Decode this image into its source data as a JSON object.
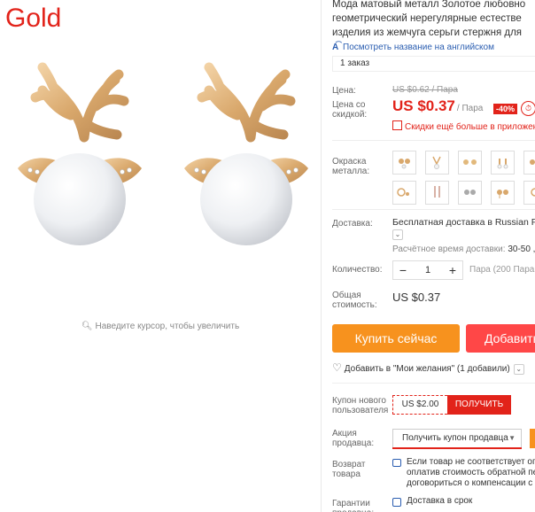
{
  "gallery": {
    "variant_label": "Gold",
    "zoom_hint": "Наведите курсор, чтобы увеличить"
  },
  "product": {
    "title_lines": [
      "Мода матовый металл Золотое любовно",
      "геометрический нерегулярные естестве",
      "изделия из жемчуга серьги стержня для"
    ],
    "translate_link": "Посмотреть название на английском",
    "orders": "1 заказ"
  },
  "price": {
    "label": "Цена:",
    "old": "US $0.62 / Пара",
    "discount_label": "Цена со скидкой:",
    "new": "US $0.37",
    "unit": "/ Пара",
    "discount_badge": "-40%",
    "discounts_more": "Скидки ещё больше в приложен"
  },
  "options": {
    "color_label": "Окраска металла:",
    "swatch_count": 12
  },
  "shipping": {
    "label": "Доставка:",
    "value": "Бесплатная доставка в Russian Fe",
    "time_label": "Расчётное время доставки:",
    "time_value": "30-50 ,"
  },
  "quantity": {
    "label": "Количество:",
    "value": "1",
    "minus": "−",
    "plus": "+",
    "note": "Пара (200 Пара д"
  },
  "total": {
    "label": "Общая стоимость:",
    "value": "US $0.37"
  },
  "actions": {
    "buy_now": "Купить сейчас",
    "add_to_cart": "Добавить",
    "wishlist": "Добавить в \"Мои желания\" (1 добавили)"
  },
  "coupons": {
    "new_user_label": "Купон нового пользователя",
    "new_user_amount": "US $2.00",
    "get_button": "ПОЛУЧИТЬ",
    "seller_label": "Акция продавца:",
    "seller_select": "Получить купон продавца"
  },
  "returns": {
    "label": "Возврат товара",
    "lines": [
      "Если товар не соответствует опи",
      "оплатив стоимость обратной пе",
      "договориться о компенсации с"
    ]
  },
  "guarantees": {
    "label": "Гарантии продавца:",
    "text": "Доставка в срок"
  },
  "colors": {
    "accent_red": "#e2231a",
    "buy_orange": "#f7921e",
    "cart_red": "#ff4747",
    "link_blue": "#2a5db0",
    "gold": "#d9a86c"
  }
}
